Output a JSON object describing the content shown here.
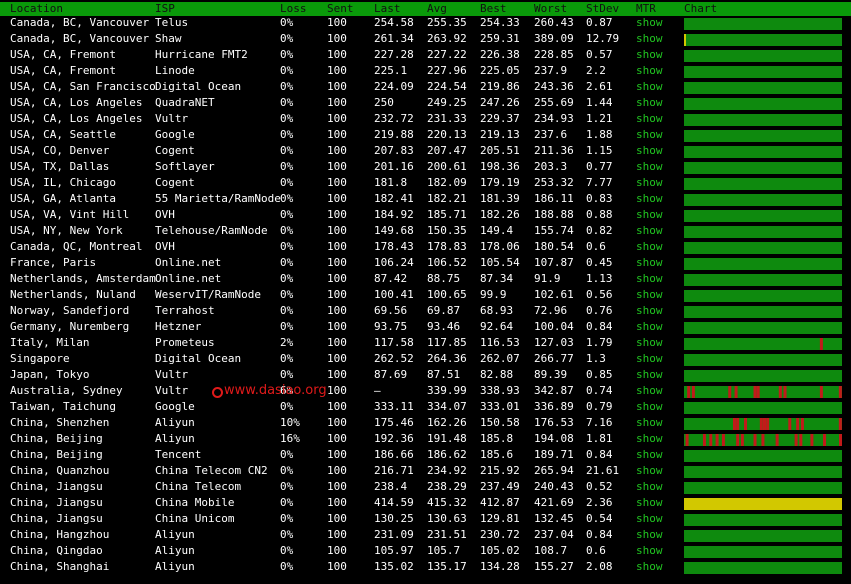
{
  "columns": [
    "Location",
    "ISP",
    "Loss",
    "Sent",
    "Last",
    "Avg",
    "Best",
    "Worst",
    "StDev",
    "MTR",
    "Chart"
  ],
  "colors": {
    "header_bg": "#0a9a0a",
    "ok": "#0e8a0e",
    "loss": "#c21a1a",
    "warn": "#d2c800",
    "link": "#21c521"
  },
  "watermark": "www.dasiao.org",
  "rows": [
    {
      "location": "Canada, BC, Vancouver",
      "isp": "Telus",
      "loss": "0%",
      "sent": "100",
      "last": "254.58",
      "avg": "255.35",
      "best": "254.33",
      "worst": "260.43",
      "stdev": "0.87",
      "mtr": "show",
      "chart": {
        "state": "ok",
        "spikes": []
      }
    },
    {
      "location": "Canada, BC, Vancouver",
      "isp": "Shaw",
      "loss": "0%",
      "sent": "100",
      "last": "261.34",
      "avg": "263.92",
      "best": "259.31",
      "worst": "389.09",
      "stdev": "12.79",
      "mtr": "show",
      "chart": {
        "state": "ok",
        "spikes": [],
        "yellow_mark": 0.0
      }
    },
    {
      "location": "USA, CA, Fremont",
      "isp": "Hurricane FMT2",
      "loss": "0%",
      "sent": "100",
      "last": "227.28",
      "avg": "227.22",
      "best": "226.38",
      "worst": "228.85",
      "stdev": "0.57",
      "mtr": "show",
      "chart": {
        "state": "ok",
        "spikes": []
      }
    },
    {
      "location": "USA, CA, Fremont",
      "isp": "Linode",
      "loss": "0%",
      "sent": "100",
      "last": "225.1",
      "avg": "227.96",
      "best": "225.05",
      "worst": "237.9",
      "stdev": "2.2",
      "mtr": "show",
      "chart": {
        "state": "ok",
        "spikes": []
      }
    },
    {
      "location": "USA, CA, San Francisco",
      "isp": "Digital Ocean",
      "loss": "0%",
      "sent": "100",
      "last": "224.09",
      "avg": "224.54",
      "best": "219.86",
      "worst": "243.36",
      "stdev": "2.61",
      "mtr": "show",
      "chart": {
        "state": "ok",
        "spikes": []
      }
    },
    {
      "location": "USA, CA, Los Angeles",
      "isp": "QuadraNET",
      "loss": "0%",
      "sent": "100",
      "last": "250",
      "avg": "249.25",
      "best": "247.26",
      "worst": "255.69",
      "stdev": "1.44",
      "mtr": "show",
      "chart": {
        "state": "ok",
        "spikes": []
      }
    },
    {
      "location": "USA, CA, Los Angeles",
      "isp": "Vultr",
      "loss": "0%",
      "sent": "100",
      "last": "232.72",
      "avg": "231.33",
      "best": "229.37",
      "worst": "234.93",
      "stdev": "1.21",
      "mtr": "show",
      "chart": {
        "state": "ok",
        "spikes": []
      }
    },
    {
      "location": "USA, CA, Seattle",
      "isp": "Google",
      "loss": "0%",
      "sent": "100",
      "last": "219.88",
      "avg": "220.13",
      "best": "219.13",
      "worst": "237.6",
      "stdev": "1.88",
      "mtr": "show",
      "chart": {
        "state": "ok",
        "spikes": []
      }
    },
    {
      "location": "USA, CO, Denver",
      "isp": "Cogent",
      "loss": "0%",
      "sent": "100",
      "last": "207.83",
      "avg": "207.47",
      "best": "205.51",
      "worst": "211.36",
      "stdev": "1.15",
      "mtr": "show",
      "chart": {
        "state": "ok",
        "spikes": []
      }
    },
    {
      "location": "USA, TX, Dallas",
      "isp": "Softlayer",
      "loss": "0%",
      "sent": "100",
      "last": "201.16",
      "avg": "200.61",
      "best": "198.36",
      "worst": "203.3",
      "stdev": "0.77",
      "mtr": "show",
      "chart": {
        "state": "ok",
        "spikes": []
      }
    },
    {
      "location": "USA, IL, Chicago",
      "isp": "Cogent",
      "loss": "0%",
      "sent": "100",
      "last": "181.8",
      "avg": "182.09",
      "best": "179.19",
      "worst": "253.32",
      "stdev": "7.77",
      "mtr": "show",
      "chart": {
        "state": "ok",
        "spikes": []
      }
    },
    {
      "location": "USA, GA, Atlanta",
      "isp": "55 Marietta/RamNode",
      "loss": "0%",
      "sent": "100",
      "last": "182.41",
      "avg": "182.21",
      "best": "181.39",
      "worst": "186.11",
      "stdev": "0.83",
      "mtr": "show",
      "chart": {
        "state": "ok",
        "spikes": []
      }
    },
    {
      "location": "USA, VA, Vint Hill",
      "isp": "OVH",
      "loss": "0%",
      "sent": "100",
      "last": "184.92",
      "avg": "185.71",
      "best": "182.26",
      "worst": "188.88",
      "stdev": "0.88",
      "mtr": "show",
      "chart": {
        "state": "ok",
        "spikes": []
      }
    },
    {
      "location": "USA, NY, New York",
      "isp": "Telehouse/RamNode",
      "loss": "0%",
      "sent": "100",
      "last": "149.68",
      "avg": "150.35",
      "best": "149.4",
      "worst": "155.74",
      "stdev": "0.82",
      "mtr": "show",
      "chart": {
        "state": "ok",
        "spikes": []
      }
    },
    {
      "location": "Canada, QC, Montreal",
      "isp": "OVH",
      "loss": "0%",
      "sent": "100",
      "last": "178.43",
      "avg": "178.83",
      "best": "178.06",
      "worst": "180.54",
      "stdev": "0.6",
      "mtr": "show",
      "chart": {
        "state": "ok",
        "spikes": []
      }
    },
    {
      "location": "France, Paris",
      "isp": "Online.net",
      "loss": "0%",
      "sent": "100",
      "last": "106.24",
      "avg": "106.52",
      "best": "105.54",
      "worst": "107.87",
      "stdev": "0.45",
      "mtr": "show",
      "chart": {
        "state": "ok",
        "spikes": []
      }
    },
    {
      "location": "Netherlands, Amsterdam",
      "isp": "Online.net",
      "loss": "0%",
      "sent": "100",
      "last": "87.42",
      "avg": "88.75",
      "best": "87.34",
      "worst": "91.9",
      "stdev": "1.13",
      "mtr": "show",
      "chart": {
        "state": "ok",
        "spikes": []
      }
    },
    {
      "location": "Netherlands, Nuland",
      "isp": "WeservIT/RamNode",
      "loss": "0%",
      "sent": "100",
      "last": "100.41",
      "avg": "100.65",
      "best": "99.9",
      "worst": "102.61",
      "stdev": "0.56",
      "mtr": "show",
      "chart": {
        "state": "ok",
        "spikes": []
      }
    },
    {
      "location": "Norway, Sandefjord",
      "isp": "Terrahost",
      "loss": "0%",
      "sent": "100",
      "last": "69.56",
      "avg": "69.87",
      "best": "68.93",
      "worst": "72.96",
      "stdev": "0.76",
      "mtr": "show",
      "chart": {
        "state": "ok",
        "spikes": []
      }
    },
    {
      "location": "Germany, Nuremberg",
      "isp": "Hetzner",
      "loss": "0%",
      "sent": "100",
      "last": "93.75",
      "avg": "93.46",
      "best": "92.64",
      "worst": "100.04",
      "stdev": "0.84",
      "mtr": "show",
      "chart": {
        "state": "ok",
        "spikes": []
      }
    },
    {
      "location": "Italy, Milan",
      "isp": "Prometeus",
      "loss": "2%",
      "sent": "100",
      "last": "117.58",
      "avg": "117.85",
      "best": "116.53",
      "worst": "127.03",
      "stdev": "1.79",
      "mtr": "show",
      "chart": {
        "state": "ok",
        "spikes": [
          0.86
        ]
      }
    },
    {
      "location": "Singapore",
      "isp": "Digital Ocean",
      "loss": "0%",
      "sent": "100",
      "last": "262.52",
      "avg": "264.36",
      "best": "262.07",
      "worst": "266.77",
      "stdev": "1.3",
      "mtr": "show",
      "chart": {
        "state": "ok",
        "spikes": []
      }
    },
    {
      "location": "Japan, Tokyo",
      "isp": "Vultr",
      "loss": "0%",
      "sent": "100",
      "last": "87.69",
      "avg": "87.51",
      "best": "82.88",
      "worst": "89.39",
      "stdev": "0.85",
      "mtr": "show",
      "chart": {
        "state": "ok",
        "spikes": []
      }
    },
    {
      "location": "Australia, Sydney",
      "isp": "Vultr",
      "loss": "6%",
      "sent": "100",
      "last": "–",
      "avg": "339.99",
      "best": "338.93",
      "worst": "342.87",
      "stdev": "0.74",
      "mtr": "show",
      "chart": {
        "state": "ok",
        "spikes": [
          0.02,
          0.05,
          0.28,
          0.32,
          0.44,
          0.46,
          0.6,
          0.63,
          0.86,
          0.98
        ]
      }
    },
    {
      "location": "Taiwan, Taichung",
      "isp": "Google",
      "loss": "0%",
      "sent": "100",
      "last": "333.11",
      "avg": "334.07",
      "best": "333.01",
      "worst": "336.89",
      "stdev": "0.79",
      "mtr": "show",
      "chart": {
        "state": "ok",
        "spikes": []
      }
    },
    {
      "location": "China, Shenzhen",
      "isp": "Aliyun",
      "loss": "10%",
      "sent": "100",
      "last": "175.46",
      "avg": "162.26",
      "best": "150.58",
      "worst": "176.53",
      "stdev": "7.16",
      "mtr": "show",
      "chart": {
        "state": "ok",
        "spikes": [
          0.31,
          0.33,
          0.38,
          0.48,
          0.5,
          0.52,
          0.66,
          0.71,
          0.74,
          0.98
        ]
      }
    },
    {
      "location": "China, Beijing",
      "isp": "Aliyun",
      "loss": "16%",
      "sent": "100",
      "last": "192.36",
      "avg": "191.48",
      "best": "185.8",
      "worst": "194.08",
      "stdev": "1.81",
      "mtr": "show",
      "chart": {
        "state": "ok",
        "spikes": [
          0.01,
          0.12,
          0.16,
          0.2,
          0.24,
          0.33,
          0.36,
          0.44,
          0.49,
          0.58,
          0.7,
          0.73,
          0.8,
          0.88,
          0.99
        ]
      }
    },
    {
      "location": "China, Beijing",
      "isp": "Tencent",
      "loss": "0%",
      "sent": "100",
      "last": "186.66",
      "avg": "186.62",
      "best": "185.6",
      "worst": "189.71",
      "stdev": "0.84",
      "mtr": "show",
      "chart": {
        "state": "ok",
        "spikes": []
      }
    },
    {
      "location": "China, Quanzhou",
      "isp": "China Telecom CN2",
      "loss": "0%",
      "sent": "100",
      "last": "216.71",
      "avg": "234.92",
      "best": "215.92",
      "worst": "265.94",
      "stdev": "21.61",
      "mtr": "show",
      "chart": {
        "state": "ok",
        "spikes": []
      }
    },
    {
      "location": "China, Jiangsu",
      "isp": "China Telecom",
      "loss": "0%",
      "sent": "100",
      "last": "238.4",
      "avg": "238.29",
      "best": "237.49",
      "worst": "240.43",
      "stdev": "0.52",
      "mtr": "show",
      "chart": {
        "state": "ok",
        "spikes": []
      }
    },
    {
      "location": "China, Jiangsu",
      "isp": "China Mobile",
      "loss": "0%",
      "sent": "100",
      "last": "414.59",
      "avg": "415.32",
      "best": "412.87",
      "worst": "421.69",
      "stdev": "2.36",
      "mtr": "show",
      "chart": {
        "state": "warn",
        "spikes": []
      }
    },
    {
      "location": "China, Jiangsu",
      "isp": "China Unicom",
      "loss": "0%",
      "sent": "100",
      "last": "130.25",
      "avg": "130.63",
      "best": "129.81",
      "worst": "132.45",
      "stdev": "0.54",
      "mtr": "show",
      "chart": {
        "state": "ok",
        "spikes": []
      }
    },
    {
      "location": "China, Hangzhou",
      "isp": "Aliyun",
      "loss": "0%",
      "sent": "100",
      "last": "231.09",
      "avg": "231.51",
      "best": "230.72",
      "worst": "237.04",
      "stdev": "0.84",
      "mtr": "show",
      "chart": {
        "state": "ok",
        "spikes": []
      }
    },
    {
      "location": "China, Qingdao",
      "isp": "Aliyun",
      "loss": "0%",
      "sent": "100",
      "last": "105.97",
      "avg": "105.7",
      "best": "105.02",
      "worst": "108.7",
      "stdev": "0.6",
      "mtr": "show",
      "chart": {
        "state": "ok",
        "spikes": []
      }
    },
    {
      "location": "China, Shanghai",
      "isp": "Aliyun",
      "loss": "0%",
      "sent": "100",
      "last": "135.02",
      "avg": "135.17",
      "best": "134.28",
      "worst": "155.27",
      "stdev": "2.08",
      "mtr": "show",
      "chart": {
        "state": "ok",
        "spikes": []
      }
    }
  ]
}
